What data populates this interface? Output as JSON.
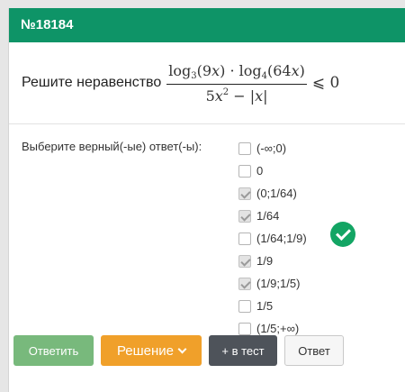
{
  "header": {
    "title": "№18184"
  },
  "problem": {
    "prompt": "Решите неравенство",
    "formula": {
      "num_log1": "log",
      "num_base1": "3",
      "num_arg1": "(9",
      "num_var1": "x",
      "num_close1": ")",
      "dot": "·",
      "num_log2": "log",
      "num_base2": "4",
      "num_arg2": "(64",
      "num_var2": "x",
      "num_close2": ")",
      "den_coef": "5",
      "den_var": "x",
      "den_exp": "2",
      "den_rest": " − |",
      "den_abs_var": "x",
      "den_abs_close": "|",
      "relation": "⩽ 0"
    }
  },
  "answers": {
    "label": "Выберите верный(-ые) ответ(-ы):",
    "options": [
      {
        "label": "(-∞;0)",
        "checked": false
      },
      {
        "label": "0",
        "checked": false
      },
      {
        "label": "(0;1/64)",
        "checked": true
      },
      {
        "label": "1/64",
        "checked": true
      },
      {
        "label": "(1/64;1/9)",
        "checked": false
      },
      {
        "label": "1/9",
        "checked": true
      },
      {
        "label": "(1/9;1/5)",
        "checked": true
      },
      {
        "label": "1/5",
        "checked": false
      },
      {
        "label": "(1/5;+∞)",
        "checked": false
      }
    ],
    "status_icon": "check-circle-icon"
  },
  "buttons": {
    "answer": "Ответить",
    "solution": "Решение",
    "add_to_test": "+ в тест",
    "reply": "Ответ"
  },
  "colors": {
    "header": "#0e9467",
    "success": "#13a564",
    "answer_button": "#78b97c",
    "solution_button": "#f0a02a",
    "test_button": "#4e535a"
  }
}
